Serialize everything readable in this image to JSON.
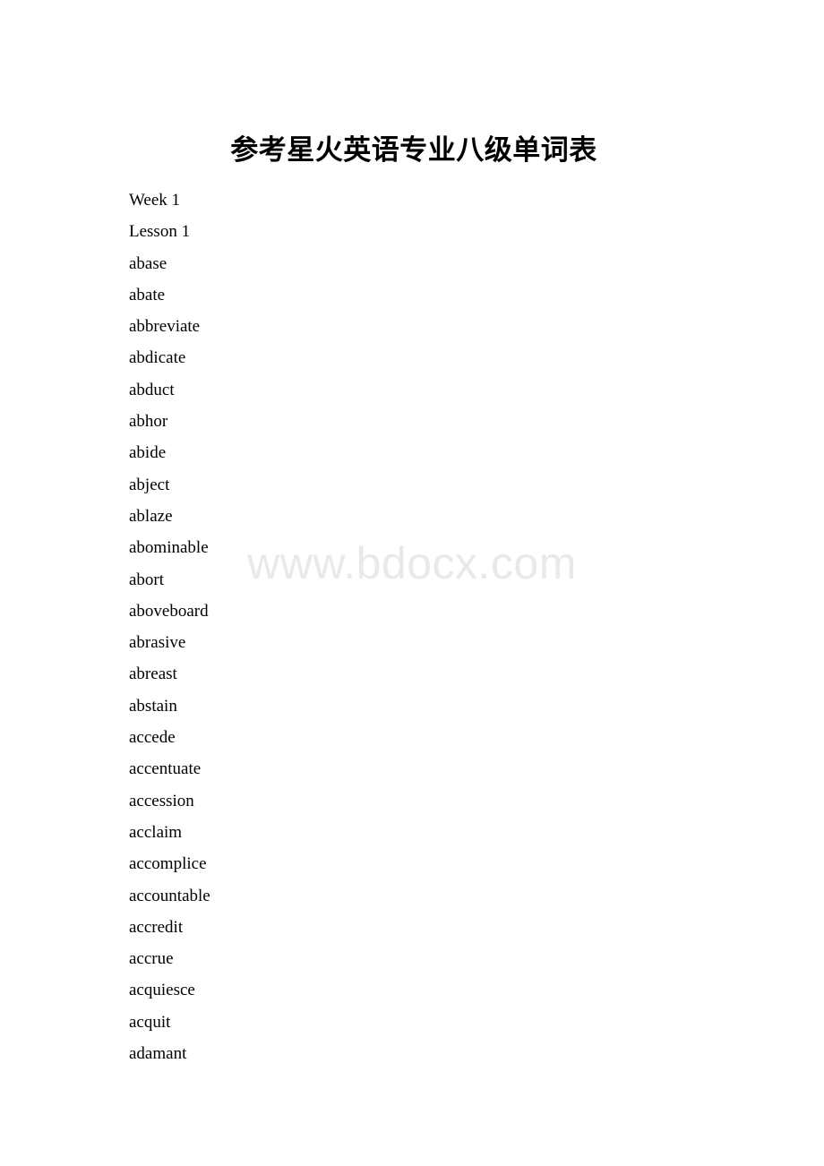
{
  "document": {
    "title": "参考星火英语专业八级单词表",
    "watermark": "www.bdocx.com",
    "background_color": "#ffffff",
    "text_color": "#000000",
    "watermark_color": "#e9e9e9",
    "lines": [
      "Week 1",
      "Lesson 1",
      "abase",
      "abate",
      "abbreviate",
      "abdicate",
      "abduct",
      "abhor",
      "abide",
      "abject",
      "ablaze",
      "abominable",
      "abort",
      "aboveboard",
      "abrasive",
      "abreast",
      "abstain",
      "accede",
      "accentuate",
      "accession",
      "acclaim",
      "accomplice",
      "accountable",
      "accredit",
      "accrue",
      "acquiesce",
      "acquit",
      "adamant"
    ]
  }
}
